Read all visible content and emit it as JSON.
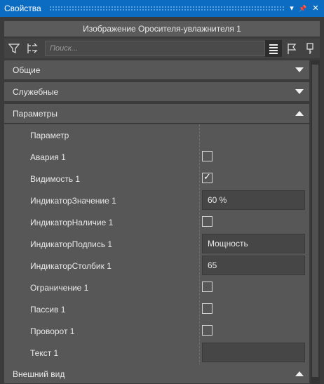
{
  "window": {
    "title": "Свойства",
    "buttons": [
      "▾",
      "📌",
      "✕"
    ]
  },
  "header": {
    "title": "Изображение Оросителя-увлажнителя 1"
  },
  "toolbar": {
    "search_placeholder": "Поиск..."
  },
  "sections": {
    "general": "Общие",
    "service": "Служебные",
    "parameters": "Параметры",
    "appearance": "Внешний вид"
  },
  "params": {
    "header": "Параметр",
    "rows": [
      {
        "name": "Авария 1",
        "type": "checkbox",
        "checked": false
      },
      {
        "name": "Видимость 1",
        "type": "checkbox",
        "checked": true
      },
      {
        "name": "ИндикаторЗначение 1",
        "type": "text",
        "value": "60 %"
      },
      {
        "name": "ИндикаторНаличие 1",
        "type": "checkbox",
        "checked": false
      },
      {
        "name": "ИндикаторПодпись 1",
        "type": "text",
        "value": "Мощность"
      },
      {
        "name": "ИндикаторСтолбик 1",
        "type": "text",
        "value": "65"
      },
      {
        "name": "Ограничение 1",
        "type": "checkbox",
        "checked": false
      },
      {
        "name": "Пассив 1",
        "type": "checkbox",
        "checked": false
      },
      {
        "name": "Проворот 1",
        "type": "checkbox",
        "checked": false
      },
      {
        "name": "Текст 1",
        "type": "text",
        "value": ""
      }
    ]
  }
}
